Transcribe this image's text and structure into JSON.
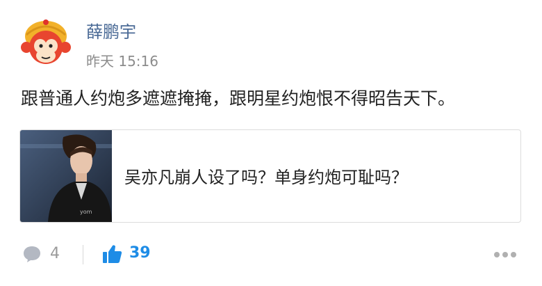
{
  "post": {
    "author": "薛鹏宇",
    "timestamp": "昨天 15:16",
    "text": "跟普通人约炮多遮遮掩掩，跟明星约炮恨不得昭告天下。"
  },
  "card": {
    "title": "吴亦凡崩人设了吗？单身约炮可耻吗？"
  },
  "actions": {
    "comments": "4",
    "likes": "39"
  },
  "icons": {
    "avatar": "monkey-king-avatar",
    "comment": "comment-bubble-icon",
    "like": "thumbs-up-icon",
    "more": "more-dots-icon"
  },
  "colors": {
    "author": "#4a6a96",
    "like_accent": "#1e8ce6",
    "muted": "#9a9a9a"
  }
}
